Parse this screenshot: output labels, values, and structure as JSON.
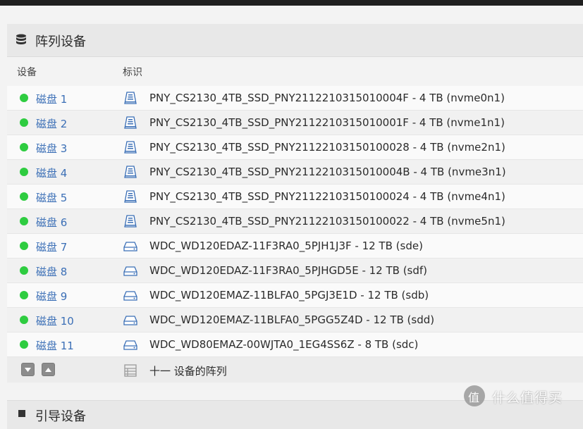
{
  "panel": {
    "title": "阵列设备",
    "icon": "database-icon",
    "columns": {
      "device": "设备",
      "identifier": "标识"
    }
  },
  "colors": {
    "online": "#2ecc40",
    "link": "#3b6fb6"
  },
  "devices": [
    {
      "name": "磁盘 1",
      "identifier": "PNY_CS2130_4TB_SSD_PNY2112210315010004F - 4 TB (nvme0n1)",
      "type": "ssd-icon",
      "status": "online"
    },
    {
      "name": "磁盘 2",
      "identifier": "PNY_CS2130_4TB_SSD_PNY2112210315010001F - 4 TB (nvme1n1)",
      "type": "ssd-icon",
      "status": "online"
    },
    {
      "name": "磁盘 3",
      "identifier": "PNY_CS2130_4TB_SSD_PNY21122103150100028 - 4 TB (nvme2n1)",
      "type": "ssd-icon",
      "status": "online"
    },
    {
      "name": "磁盘 4",
      "identifier": "PNY_CS2130_4TB_SSD_PNY2112210315010004B - 4 TB (nvme3n1)",
      "type": "ssd-icon",
      "status": "online"
    },
    {
      "name": "磁盘 5",
      "identifier": "PNY_CS2130_4TB_SSD_PNY21122103150100024 - 4 TB (nvme4n1)",
      "type": "ssd-icon",
      "status": "online"
    },
    {
      "name": "磁盘 6",
      "identifier": "PNY_CS2130_4TB_SSD_PNY21122103150100022 - 4 TB (nvme5n1)",
      "type": "ssd-icon",
      "status": "online"
    },
    {
      "name": "磁盘 7",
      "identifier": "WDC_WD120EDAZ-11F3RA0_5PJH1J3F - 12 TB (sde)",
      "type": "hdd-icon",
      "status": "online"
    },
    {
      "name": "磁盘 8",
      "identifier": "WDC_WD120EDAZ-11F3RA0_5PJHGD5E - 12 TB (sdf)",
      "type": "hdd-icon",
      "status": "online"
    },
    {
      "name": "磁盘 9",
      "identifier": "WDC_WD120EMAZ-11BLFA0_5PGJ3E1D - 12 TB (sdb)",
      "type": "hdd-icon",
      "status": "online"
    },
    {
      "name": "磁盘 10",
      "identifier": "WDC_WD120EMAZ-11BLFA0_5PGG5Z4D - 12 TB (sdd)",
      "type": "hdd-icon",
      "status": "online"
    },
    {
      "name": "磁盘 11",
      "identifier": "WDC_WD80EMAZ-00WJTA0_1EG4SS6Z - 8 TB (sdc)",
      "type": "hdd-icon",
      "status": "online"
    }
  ],
  "footer": {
    "summary": "十一 设备的阵列"
  },
  "panel2": {
    "title": "引导设备"
  },
  "watermark": {
    "text": "什么值得买",
    "logo_glyph": "值"
  }
}
